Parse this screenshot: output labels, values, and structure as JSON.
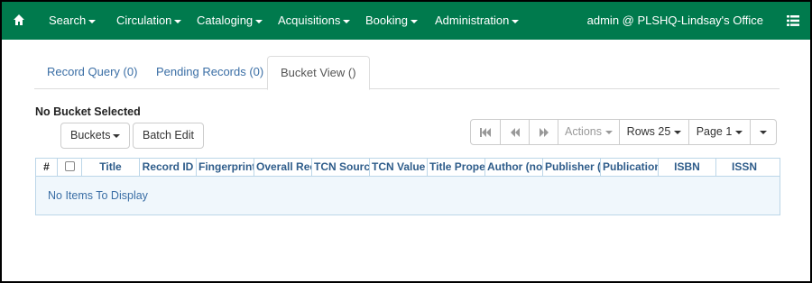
{
  "navbar": {
    "home_icon": "home-icon",
    "items": [
      {
        "label": "Search"
      },
      {
        "label": "Circulation"
      },
      {
        "label": "Cataloging"
      },
      {
        "label": "Acquisitions"
      },
      {
        "label": "Booking"
      },
      {
        "label": "Administration"
      }
    ],
    "user": "admin @ PLSHQ-Lindsay's Office",
    "menu_icon": "list-menu-icon",
    "color": "#007a4d"
  },
  "tabs": [
    {
      "label": "Record Query (0)",
      "active": false
    },
    {
      "label": "Pending Records (0)",
      "active": false
    },
    {
      "label": "Bucket View ()",
      "active": true
    }
  ],
  "bucket_heading": "No Bucket Selected",
  "buttons": {
    "buckets": "Buckets",
    "batch_edit": "Batch Edit"
  },
  "toolbar": {
    "first_icon": "first-page-icon",
    "prev_icon": "previous-page-icon",
    "next_icon": "next-page-icon",
    "actions": "Actions",
    "rows": "Rows 25",
    "page": "Page 1"
  },
  "grid": {
    "columns": [
      "#",
      "",
      "Title",
      "Record ID",
      "Fingerprint",
      "Overall Rec",
      "TCN Source",
      "TCN Value",
      "Title Proper",
      "Author (nor",
      "Publisher (r",
      "Publication",
      "ISBN",
      "ISSN"
    ],
    "empty_message": "No Items To Display"
  }
}
